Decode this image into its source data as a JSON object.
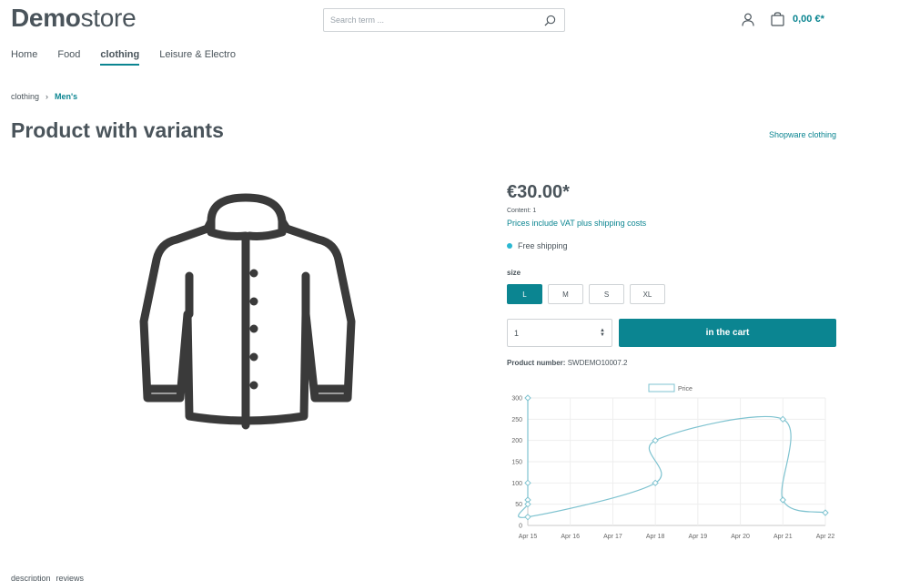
{
  "header": {
    "logo_bold": "Demo",
    "logo_light": "store",
    "search_placeholder": "Search term ...",
    "cart_total": "0,00 €*"
  },
  "nav": {
    "items": [
      {
        "label": "Home"
      },
      {
        "label": "Food"
      },
      {
        "label": "clothing",
        "active": true
      },
      {
        "label": "Leisure & Electro"
      }
    ]
  },
  "breadcrumb": {
    "items": [
      {
        "label": "clothing"
      },
      {
        "label": "Men's"
      }
    ]
  },
  "product": {
    "title": "Product with variants",
    "manufacturer": "Shopware clothing",
    "price": "€30.00*",
    "content": "Content: 1",
    "vat_note": "Prices include VAT plus shipping costs",
    "shipping": "Free shipping",
    "size_label": "size",
    "sizes": [
      "L",
      "M",
      "S",
      "XL"
    ],
    "selected_size": "L",
    "quantity": "1",
    "buy_label": "in the cart",
    "number_label": "Product number:",
    "number_value": "SWDEMO10007.2"
  },
  "tabs": {
    "description": "description",
    "reviews": "reviews"
  },
  "colors": {
    "accent": "#0b8591",
    "text": "#4a545b",
    "chart_line": "#7fc3d0",
    "shipping_dot": "#2bb8d2"
  },
  "chart_data": {
    "type": "line",
    "series": [
      {
        "name": "Price",
        "points": [
          {
            "x": "2023-04-15",
            "y": 300
          },
          {
            "x": "2023-04-15",
            "y": 100
          },
          {
            "x": "2023-04-15",
            "y": 60
          },
          {
            "x": "2023-04-15",
            "y": 50
          },
          {
            "x": "2023-04-15",
            "y": 20
          },
          {
            "x": "2023-04-18",
            "y": 100
          },
          {
            "x": "2023-04-18",
            "y": 200
          },
          {
            "x": "2023-04-21",
            "y": 250
          },
          {
            "x": "2023-04-21",
            "y": 60
          },
          {
            "x": "2023-04-22",
            "y": 30
          }
        ]
      }
    ],
    "x_ticks": [
      "Apr 15",
      "Apr 16",
      "Apr 17",
      "Apr 18",
      "Apr 19",
      "Apr 20",
      "Apr 21",
      "Apr 22"
    ],
    "y_ticks": [
      0,
      50,
      100,
      150,
      200,
      250,
      300
    ],
    "ylim": [
      0,
      300
    ],
    "legend": "top-center",
    "grid": true
  }
}
